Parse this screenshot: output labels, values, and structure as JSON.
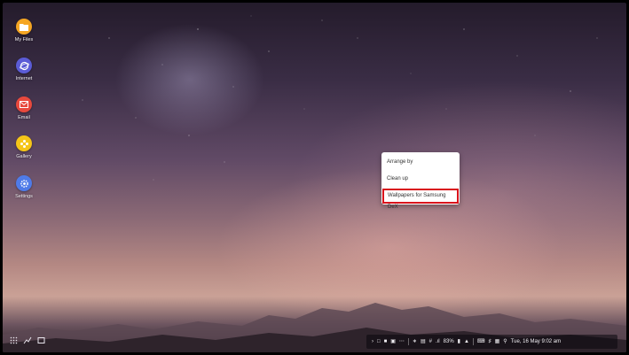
{
  "desktop": {
    "icons": [
      {
        "label": "My Files",
        "icon": "folder-icon",
        "color": "#f5a623"
      },
      {
        "label": "Internet",
        "icon": "globe-icon",
        "color": "#5b5cd6"
      },
      {
        "label": "Email",
        "icon": "envelope-icon",
        "color": "#e8493d"
      },
      {
        "label": "Gallery",
        "icon": "flower-icon",
        "color": "#f5c518"
      },
      {
        "label": "Settings",
        "icon": "gear-icon",
        "color": "#4f7be8"
      }
    ]
  },
  "context_menu": {
    "items": [
      {
        "label": "Arrange by"
      },
      {
        "label": "Clean up"
      },
      {
        "label": "Wallpapers for Samsung DeX",
        "highlighted": true
      }
    ],
    "highlight_color": "#d9131c"
  },
  "taskbar": {
    "left_icons": [
      "apps-grid-icon",
      "pen-icon",
      "window-icon"
    ],
    "tray": {
      "battery_text": "83%",
      "datetime": "Tue, 16 May 9:02 am"
    }
  }
}
